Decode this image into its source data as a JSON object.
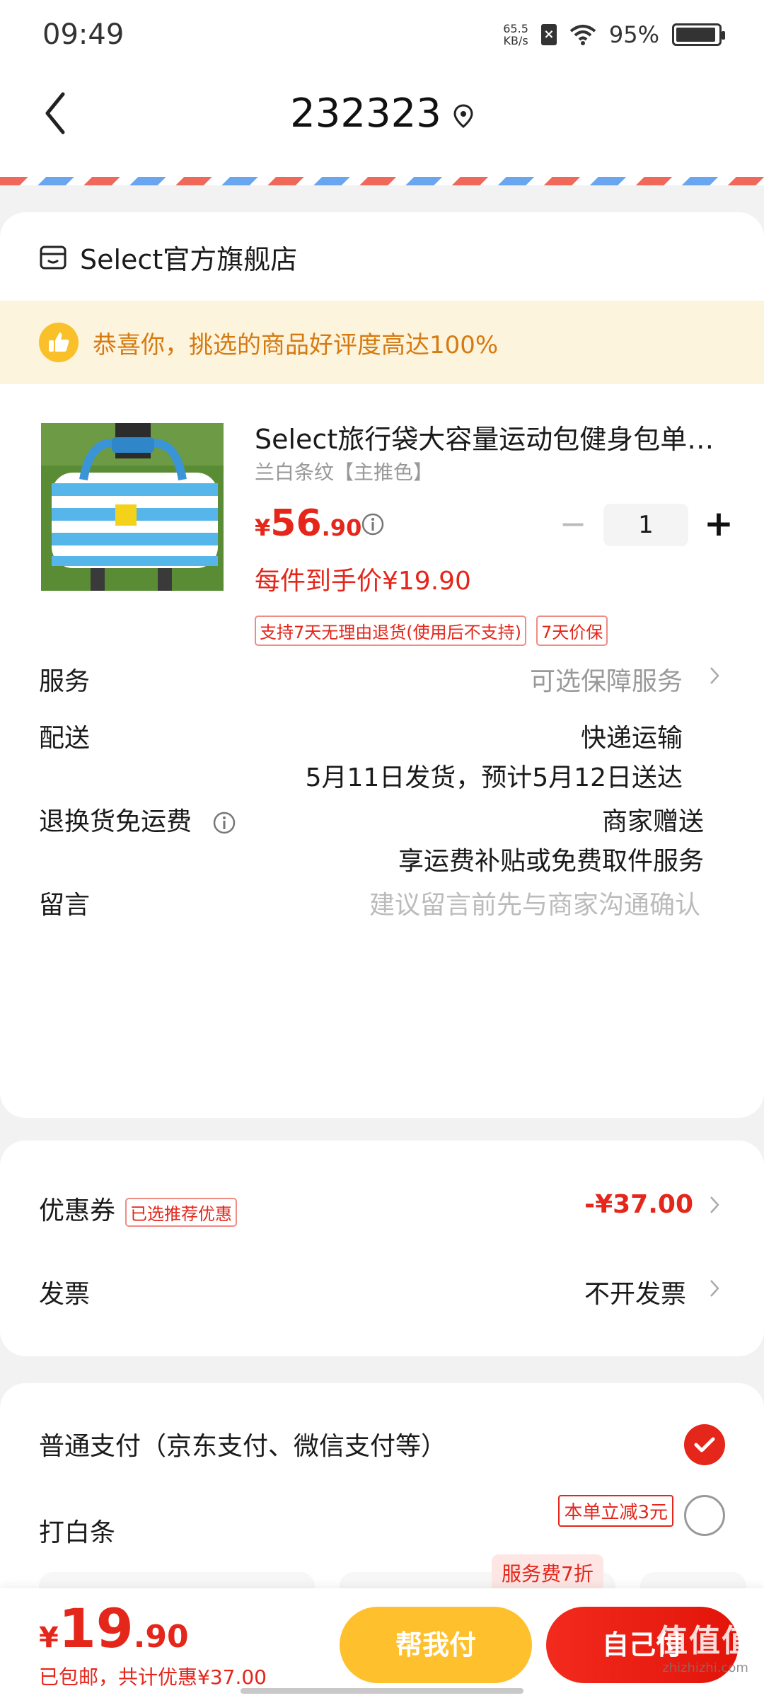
{
  "status_bar": {
    "time": "09:49",
    "net_speed_value": "65.5",
    "net_speed_unit": "KB/s",
    "battery_percent": "95%",
    "battery_level": 0.95
  },
  "header": {
    "title": "232323"
  },
  "shop": {
    "name": "Select官方旗舰店",
    "banner_text": "恭喜你，挑选的商品好评度高达100%"
  },
  "product": {
    "title": "Select旅行袋大容量运动包健身包单…",
    "spec": "兰白条纹【主推色】",
    "price_symbol": "¥",
    "price_int": "56",
    "price_dec": ".90",
    "quantity": "1",
    "unit_price_text": "每件到手价¥19.90",
    "tags": [
      "支持7天无理由退货(使用后不支持)",
      "7天价保"
    ]
  },
  "rows": {
    "service_label": "服务",
    "service_value": "可选保障服务",
    "delivery_label": "配送",
    "delivery_method": "快递运输",
    "delivery_time": "5月11日发货，预计5月12日送达",
    "return_label": "退换货免运费",
    "return_value": "商家赠送",
    "return_desc": "享运费补贴或免费取件服务",
    "message_label": "留言",
    "message_placeholder": "建议留言前先与商家沟通确认"
  },
  "coupon": {
    "label": "优惠券",
    "badge": "已选推荐优惠",
    "amount": "-¥37.00",
    "invoice_label": "发票",
    "invoice_value": "不开发票"
  },
  "payment": {
    "normal_label": "普通支付（京东支付、微信支付等）",
    "baitiao_label": "打白条",
    "baitiao_promo": "本单立减3元",
    "fee_tag": "服务费7折"
  },
  "bottom": {
    "total_symbol": "¥",
    "total_int": "19",
    "total_dec": ".90",
    "shipping_note": "已包邮，共计优惠",
    "discount_amount": "¥37.00",
    "help_pay_label": "帮我付",
    "self_pay_label": "自己付",
    "watermark": "值值值",
    "watermark_url": "zhizhizhi.com"
  },
  "colors": {
    "accent_red": "#e4261b",
    "help_yellow": "#ffc02e",
    "banner_bg": "#fdf4dd",
    "banner_text": "#d67a12"
  }
}
